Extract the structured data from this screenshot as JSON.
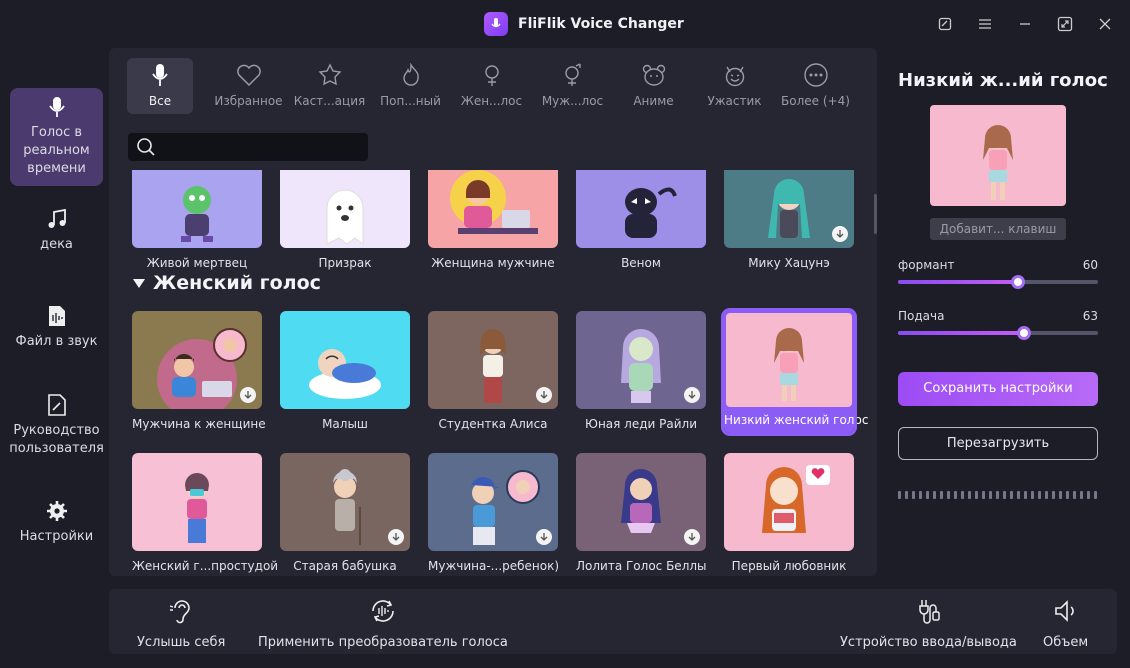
{
  "app": {
    "title": "FliFlik Voice Changer"
  },
  "window_controls": [
    "note-icon",
    "menu-icon",
    "minimize-icon",
    "maximize-icon",
    "close-icon"
  ],
  "sidebar": {
    "items": [
      {
        "label": "Голос в реальном времени",
        "icon": "microphone-icon",
        "active": true
      },
      {
        "label": "дека",
        "icon": "music-note-icon",
        "active": false
      },
      {
        "label": "Файл в звук",
        "icon": "audio-file-icon",
        "active": false
      },
      {
        "label": "Руководство пользователя",
        "icon": "guide-icon",
        "active": false
      },
      {
        "label": "Настройки",
        "icon": "gear-icon",
        "active": false
      }
    ]
  },
  "tabs": [
    {
      "label": "Все",
      "icon": "microphone-icon",
      "active": true
    },
    {
      "label": "Избранное",
      "icon": "heart-icon"
    },
    {
      "label": "Каст...ация",
      "icon": "custom-icon"
    },
    {
      "label": "Поп...ный",
      "icon": "fire-icon"
    },
    {
      "label": "Жен...лос",
      "icon": "female-icon"
    },
    {
      "label": "Муж...лос",
      "icon": "male-icon"
    },
    {
      "label": "Аниме",
      "icon": "bear-icon"
    },
    {
      "label": "Ужастик",
      "icon": "devil-icon"
    },
    {
      "label": "Более (+4)",
      "icon": "more-icon"
    }
  ],
  "search": {
    "placeholder": "",
    "value": ""
  },
  "top_row": [
    {
      "label": "Живой мертвец",
      "bg": "#a9a3f0",
      "download": false
    },
    {
      "label": "Призрак",
      "bg": "#efe6fb",
      "download": false
    },
    {
      "label": "Женщина мужчине",
      "bg": "#f7a4a6",
      "download": false
    },
    {
      "label": "Веном",
      "bg": "#9d8fe8",
      "download": false
    },
    {
      "label": "Мику Хацунэ",
      "bg": "#4e7c86",
      "download": true
    }
  ],
  "section": {
    "title": "Женский голос"
  },
  "female_row1": [
    {
      "label": "Мужчина к женщине",
      "bg": "#8b7a50",
      "download": true
    },
    {
      "label": "Малыш",
      "bg": "#4fdcf2",
      "download": false
    },
    {
      "label": "Студентка Алиса",
      "bg": "#7d6560",
      "download": true
    },
    {
      "label": "Юная леди Райли",
      "bg": "#6e6690",
      "download": true
    },
    {
      "label": "Низкий женский голос",
      "bg": "#f6b9ce",
      "download": false,
      "selected": true
    }
  ],
  "female_row2": [
    {
      "label": "Женский г...простудой",
      "bg": "#f8c0d4",
      "download": false
    },
    {
      "label": "Старая бабушка",
      "bg": "#7a6660",
      "download": true
    },
    {
      "label": "Мужчина-...ребенок)",
      "bg": "#5c6c8c",
      "download": true
    },
    {
      "label": "Лолита Голос Беллы",
      "bg": "#7a6276",
      "download": true
    },
    {
      "label": "Первый любовник",
      "bg": "#f6b9ce",
      "download": false
    }
  ],
  "right_panel": {
    "title": "Низкий ж...ий голос",
    "hotkey": "Добавит... клавиш",
    "sliders": [
      {
        "label": "формант",
        "value": "60",
        "fraction": 0.6
      },
      {
        "label": "Подача",
        "value": "63",
        "fraction": 0.63
      }
    ],
    "save": "Сохранить настройки",
    "reload": "Перезагрузить"
  },
  "bottom": {
    "items": [
      {
        "label": "Услышь себя",
        "icon": "ear-icon"
      },
      {
        "label": "Применить преобразователь голоса",
        "icon": "voice-changer-icon"
      },
      {
        "label": "Устройство ввода/вывода",
        "icon": "plug-icon"
      },
      {
        "label": "Объем",
        "icon": "volume-icon"
      }
    ]
  },
  "colors": {
    "accent": "#8b5cf6",
    "background": "#1d1d27",
    "panel": "#262633"
  }
}
